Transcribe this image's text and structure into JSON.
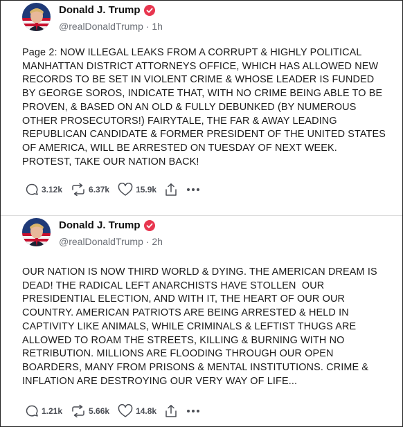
{
  "posts": [
    {
      "display_name": "Donald J. Trump",
      "handle": "@realDonaldTrump",
      "time": "1h",
      "text": "Page 2: NOW ILLEGAL LEAKS FROM A CORRUPT & HIGHLY POLITICAL\nMANHATTAN DISTRICT ATTORNEYS OFFICE, WHICH HAS ALLOWED NEW\nRECORDS TO BE SET IN VIOLENT CRIME & WHOSE LEADER IS FUNDED\nBY GEORGE SOROS, INDICATE THAT, WITH NO CRIME BEING ABLE TO BE\nPROVEN, & BASED ON AN OLD & FULLY DEBUNKED (BY NUMEROUS\nOTHER PROSECUTORS!) FAIRYTALE, THE FAR & AWAY LEADING\nREPUBLICAN CANDIDATE & FORMER PRESIDENT OF THE UNITED STATES\nOF AMERICA, WILL BE ARRESTED ON TUESDAY OF NEXT WEEK.\nPROTEST, TAKE OUR NATION BACK!",
      "replies": "3.12k",
      "retruths": "6.37k",
      "likes": "15.9k"
    },
    {
      "display_name": "Donald J. Trump",
      "handle": "@realDonaldTrump",
      "time": "2h",
      "text": "OUR NATION IS NOW THIRD WORLD & DYING. THE AMERICAN DREAM IS\nDEAD! THE RADICAL LEFT ANARCHISTS HAVE STOLLEN  OUR\nPRESIDENTIAL ELECTION, AND WITH IT, THE HEART OF OUR OUR\nCOUNTRY. AMERICAN PATRIOTS ARE BEING ARRESTED & HELD IN\nCAPTIVITY LIKE ANIMALS, WHILE CRIMINALS & LEFTIST THUGS ARE\nALLOWED TO ROAM THE STREETS, KILLING & BURNING WITH NO\nRETRIBUTION. MILLIONS ARE FLOODING THROUGH OUR OPEN\nBOARDERS, MANY FROM PRISONS & MENTAL INSTITUTIONS. CRIME &\nINFLATION ARE DESTROYING OUR VERY WAY OF LIFE...",
      "replies": "1.21k",
      "retruths": "5.66k",
      "likes": "14.8k"
    }
  ],
  "separator": " · ",
  "colors": {
    "verified_badge": "#e8364f",
    "text": "#1a1a1a",
    "muted": "#6b6f76",
    "action": "#4a4d54"
  },
  "icons": {
    "reply": "speech-bubble-icon",
    "retruth": "repost-arrows-icon",
    "like": "heart-icon",
    "share": "share-upload-icon",
    "more": "ellipsis-icon",
    "verified": "verified-badge-icon"
  }
}
